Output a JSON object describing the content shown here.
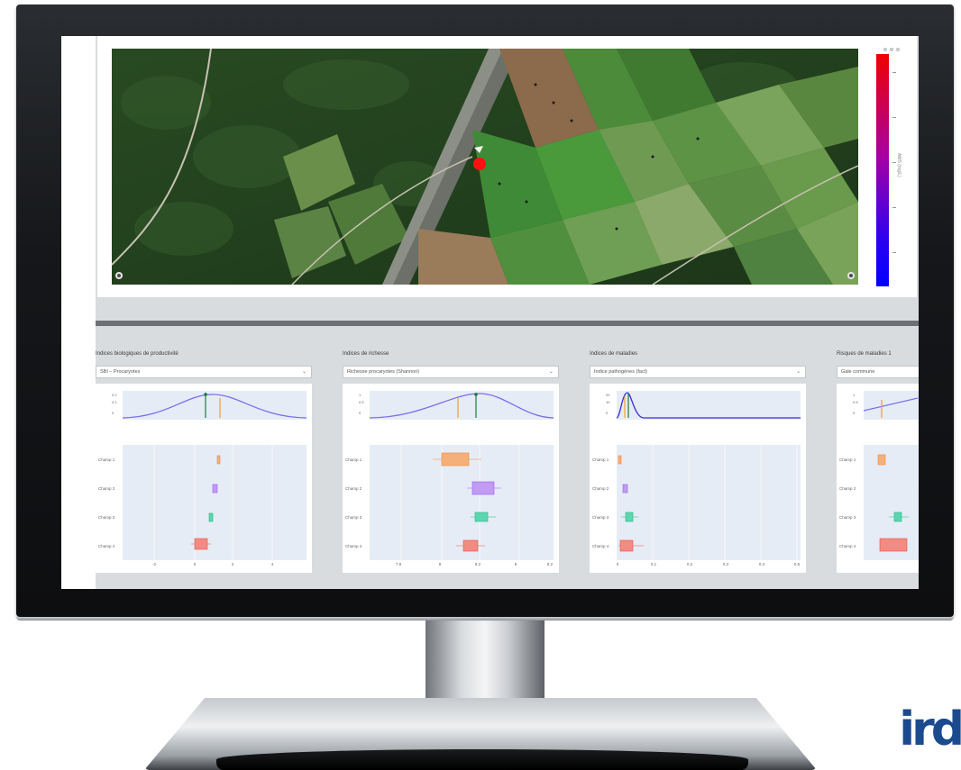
{
  "brand": {
    "logo_text": "ird"
  },
  "map": {
    "zoom_icon": "circle-icon",
    "colorbar_title": "AMS (mg/L)",
    "colorbar_colors": [
      "#ff0000",
      "#a400a6",
      "#0000ff"
    ]
  },
  "panels": [
    {
      "title": "Indices biologiques de productivité",
      "selected": "SBI – Procaryotes",
      "rows": [
        "Champ 1",
        "Champ 2",
        "Champ 3",
        "Champ 4"
      ],
      "x_ticks": [
        "-2",
        "0",
        "2",
        "4"
      ],
      "y_ticks": [
        "0.2",
        "0.1",
        "0"
      ]
    },
    {
      "title": "Indices de richesse",
      "selected": "Richesse procaryotes (Shannon)",
      "rows": [
        "Champ 1",
        "Champ 2",
        "Champ 3",
        "Champ 4"
      ],
      "x_ticks": [
        "7.8",
        "8",
        "8.2",
        "8",
        "8.2"
      ],
      "y_ticks": [
        "1",
        "0.5",
        "0"
      ]
    },
    {
      "title": "Indices de maladies",
      "selected": "Indice pathogènes (fact)",
      "rows": [
        "Champ 1",
        "Champ 2",
        "Champ 3",
        "Champ 4"
      ],
      "x_ticks": [
        "0",
        "0.1",
        "0.2",
        "0.3",
        "0.4",
        "0.5"
      ],
      "y_ticks": [
        "20",
        "10",
        "0"
      ]
    },
    {
      "title": "Risques de maladies 1",
      "selected": "Gale commune",
      "rows": [
        "Champ 1",
        "Champ 2",
        "Champ 3",
        "Champ 4"
      ],
      "x_ticks": [
        "",
        ""
      ],
      "y_ticks": [
        "1",
        "0.5",
        "0"
      ]
    }
  ]
}
